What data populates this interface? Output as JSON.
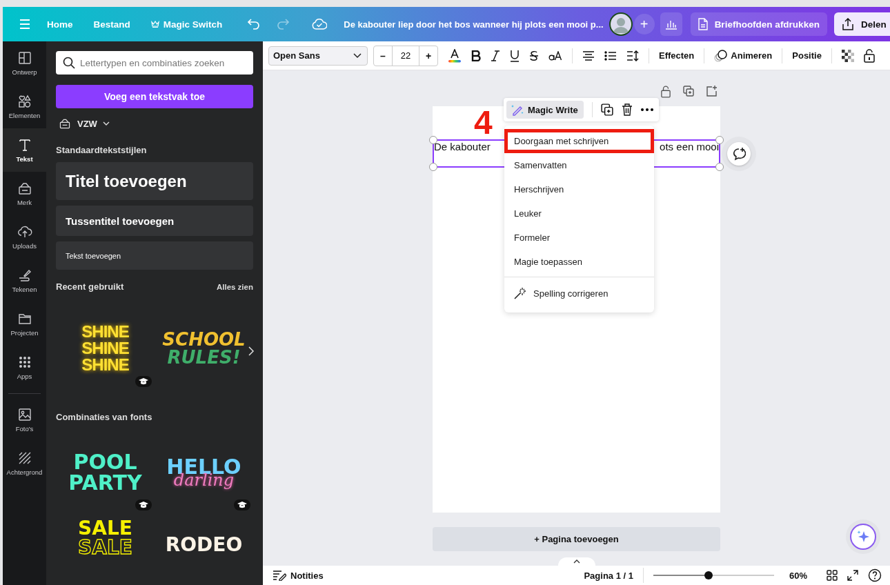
{
  "topbar": {
    "nav": [
      "Home",
      "Bestand"
    ],
    "magic_switch": "Magic Switch",
    "title": "De kabouter liep door het bos wanneer hij plots een mooi p...",
    "add": "+",
    "print_button": "Briefhoofden afdrukken",
    "share_button": "Delen"
  },
  "rail": [
    {
      "label": "Ontwerp",
      "selected": false
    },
    {
      "label": "Elementen",
      "selected": false
    },
    {
      "label": "Tekst",
      "selected": true
    },
    {
      "label": "Merk",
      "selected": false
    },
    {
      "label": "Uploads",
      "selected": false
    },
    {
      "label": "Tekenen",
      "selected": false
    },
    {
      "label": "Projecten",
      "selected": false
    },
    {
      "label": "Apps",
      "selected": false
    },
    {
      "label": "Foto's",
      "selected": false
    },
    {
      "label": "Achtergrond",
      "selected": false
    }
  ],
  "panel": {
    "search": {
      "placeholder": "Lettertypen en combinaties zoeken"
    },
    "add_button": "Voeg een tekstvak toe",
    "brand": "VZW",
    "styles_heading": "Standaardtekststijlen",
    "styles": [
      {
        "kind": "title",
        "label": "Titel toevoegen"
      },
      {
        "kind": "subtitle",
        "label": "Tussentitel toevoegen"
      },
      {
        "kind": "body",
        "label": "Tekst toevoegen"
      }
    ],
    "recent_heading": "Recent gebruikt",
    "see_all": "Alles zien",
    "recent": [
      {
        "kind": "shine",
        "lines": [
          "SHINE",
          "SHINE",
          "SHINE"
        ],
        "badge": true
      },
      {
        "kind": "school",
        "lines": [
          "SCHOOL",
          "RULES!"
        ],
        "badge": false
      }
    ],
    "combos_heading": "Combinaties van fonts",
    "combos": [
      {
        "kind": "pool",
        "lines": [
          "POOL",
          "PARTY"
        ],
        "badge": true
      },
      {
        "kind": "hello",
        "lines": [
          "HELLO",
          "darling"
        ],
        "badge": true
      },
      {
        "kind": "sale",
        "lines": [
          "SALE",
          "SALE"
        ],
        "badge": false
      },
      {
        "kind": "rodeo",
        "lines": [
          "RODEO"
        ],
        "badge": false
      }
    ]
  },
  "toolbar": {
    "font": "Open Sans",
    "minus": "–",
    "size": "22",
    "plus": "+",
    "buttons": [
      "Effecten",
      "Animeren",
      "Positie"
    ]
  },
  "canvas": {
    "text_left": "De kabouter",
    "text_right": "ots een mooi",
    "magic_write": "Magic Write",
    "step_number": "4",
    "menu": [
      {
        "kind": "option",
        "label": "Doorgaan met schrijven",
        "highlighted": true
      },
      {
        "kind": "option",
        "label": "Samenvatten",
        "highlighted": false
      },
      {
        "kind": "option",
        "label": "Herschrijven",
        "highlighted": false
      },
      {
        "kind": "option",
        "label": "Leuker",
        "highlighted": false
      },
      {
        "kind": "option",
        "label": "Formeler",
        "highlighted": false
      },
      {
        "kind": "option",
        "label": "Magie toepassen",
        "highlighted": false
      },
      {
        "kind": "tool",
        "label": "Spelling corrigeren",
        "highlighted": false
      }
    ],
    "add_page": "+ Pagina toevoegen"
  },
  "bottom": {
    "notes": "Notities",
    "page": "Pagina 1 / 1",
    "zoom": {
      "level": 0.46
    },
    "zoom_text": "60%"
  }
}
